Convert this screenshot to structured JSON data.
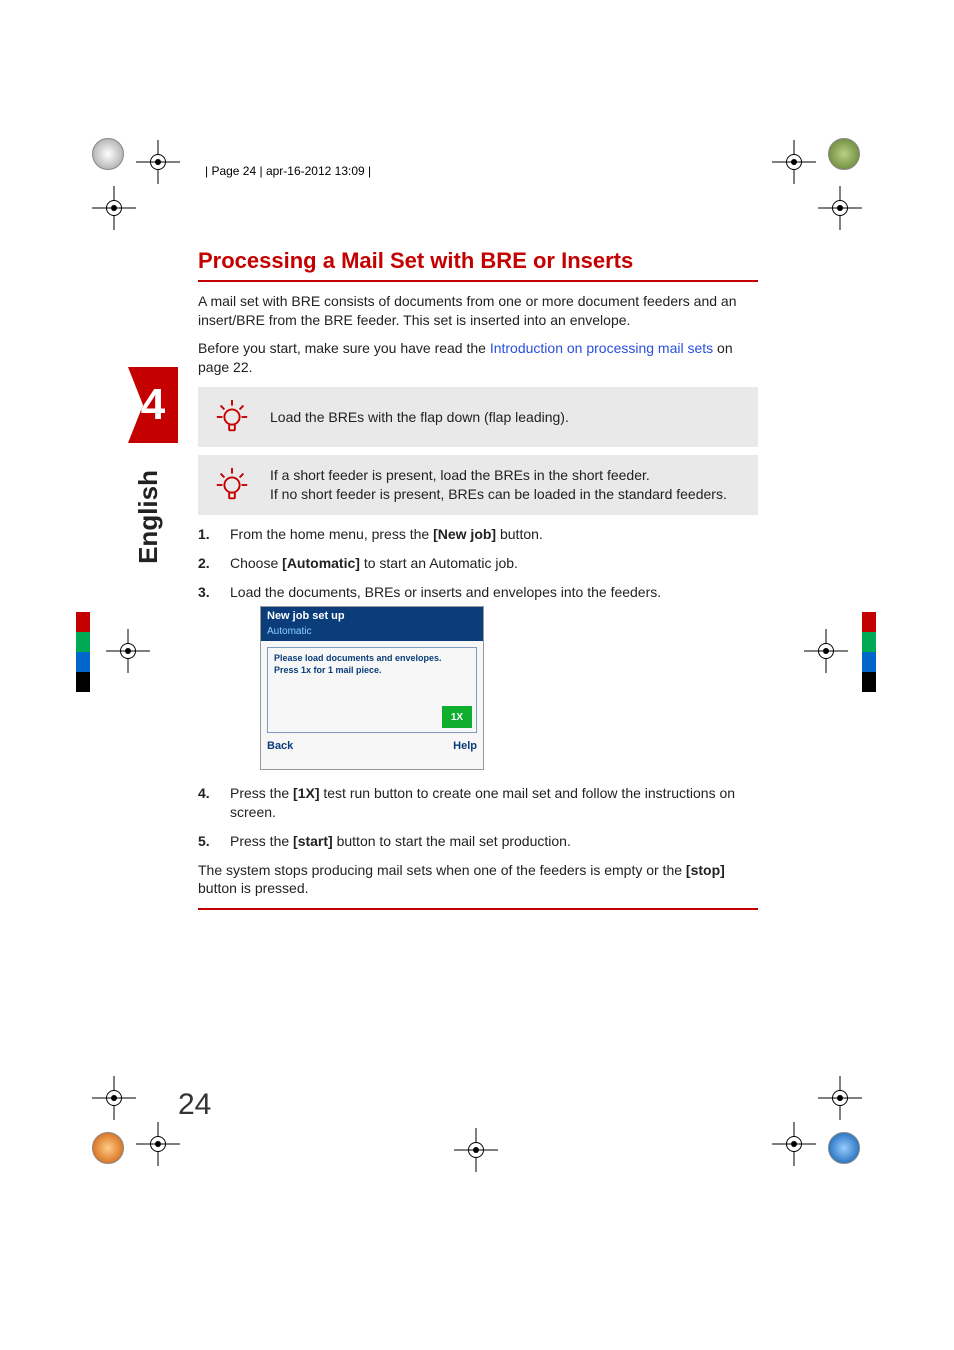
{
  "header": {
    "text": "| Page 24 | apr-16-2012 13:09 |"
  },
  "chapter": {
    "number": "4",
    "language": "English"
  },
  "title": "Processing a Mail Set with BRE or Inserts",
  "intro": "A mail set with BRE consists of documents from one or more document feeders and an insert/BRE from the BRE feeder. This set is inserted into an envelope.",
  "before_prefix": "Before you start, make sure you have read the ",
  "before_link": "Introduction on processing mail sets",
  "before_suffix": " on page 22.",
  "note1": "Load the BREs with the flap down (flap leading).",
  "note2_line1": "If a short feeder is present, load the BREs in the short feeder.",
  "note2_line2": "If no short feeder is present, BREs can be loaded in the standard feeders.",
  "steps": {
    "s1_pre": "From the home menu, press the ",
    "s1_bold": "[New job]",
    "s1_post": " button.",
    "s2_pre": "Choose ",
    "s2_bold": "[Automatic]",
    "s2_post": " to start an Automatic job.",
    "s3": "Load the documents, BREs or inserts and envelopes into the feeders.",
    "s4_pre": "Press the ",
    "s4_bold": "[1X]",
    "s4_post": " test run button to create one mail set and follow the instructions on screen.",
    "s5_pre": "Press the ",
    "s5_bold": "[start]",
    "s5_post": " button to start the mail set production."
  },
  "closing_pre": "The system stops producing mail sets when one of the feeders is empty or the ",
  "closing_bold": "[stop]",
  "closing_post": " button is pressed.",
  "mini_screen": {
    "title": "New job set up",
    "subtitle": "Automatic",
    "line1": "Please load documents and envelopes.",
    "line2": "Press 1x for 1 mail piece.",
    "btn": "1X",
    "back": "Back",
    "help": "Help"
  },
  "page_number": "24"
}
